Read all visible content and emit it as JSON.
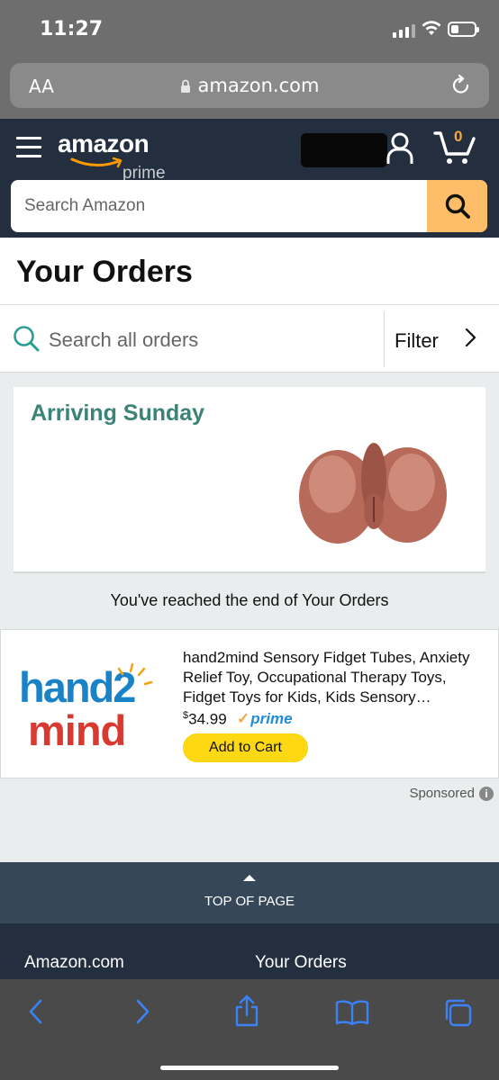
{
  "status_bar": {
    "time": "11:27"
  },
  "browser": {
    "text_size_label": "AA",
    "url": "amazon.com"
  },
  "header": {
    "logo_word": "amazon",
    "logo_sub": "prime",
    "cart_count": "0",
    "search_placeholder": "Search Amazon"
  },
  "page": {
    "title": "Your Orders",
    "order_search_placeholder": "Search all orders",
    "filter_label": "Filter"
  },
  "order": {
    "status": "Arriving Sunday"
  },
  "end_message": "You've reached the end of Your Orders",
  "sponsored_product": {
    "brand_logo_top": "hand2",
    "brand_logo_bottom": "mind",
    "title": "hand2mind Sensory Fidget Tubes, Anxiety Relief Toy, Occupational Therapy Toys, Fidget Toys for Kids, Kids Sensory…",
    "price_symbol": "$",
    "price": "34.99",
    "prime_check": "✓",
    "prime_label": "prime",
    "add_to_cart_label": "Add to Cart",
    "sponsored_label": "Sponsored",
    "info_label": "i"
  },
  "footer": {
    "top_of_page_label": "TOP OF PAGE",
    "links": [
      "Amazon.com",
      "Your Orders"
    ]
  },
  "colors": {
    "header_bg": "#232f3e",
    "accent_orange": "#febd69",
    "arriving_green": "#3a8376",
    "atc_yellow": "#ffd814",
    "safari_blue": "#3b82f6"
  }
}
